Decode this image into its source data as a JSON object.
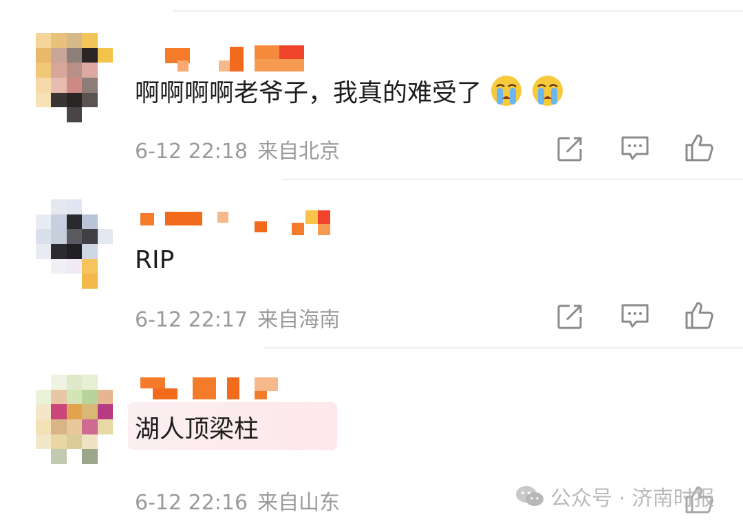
{
  "comments": [
    {
      "content": "啊啊啊啊老爷子，我真的难受了",
      "emoji": [
        "loudly-crying-face",
        "loudly-crying-face"
      ],
      "time": "6-12 22:18",
      "location": "来自北京"
    },
    {
      "content": "RIP",
      "emoji": [],
      "time": "6-12 22:17",
      "location": "来自海南"
    },
    {
      "content": "湖人顶梁柱",
      "emoji": [],
      "time": "6-12 22:16",
      "location": "来自山东"
    }
  ],
  "watermark": {
    "text": "公众号 · 济南时报",
    "icon": "wechat-icon"
  },
  "colors": {
    "text": "#1d1d1d",
    "meta": "#9a9a9a",
    "icon": "#8a8a8a",
    "divider": "#ededed",
    "username_mosaic": "#f26a1b"
  }
}
